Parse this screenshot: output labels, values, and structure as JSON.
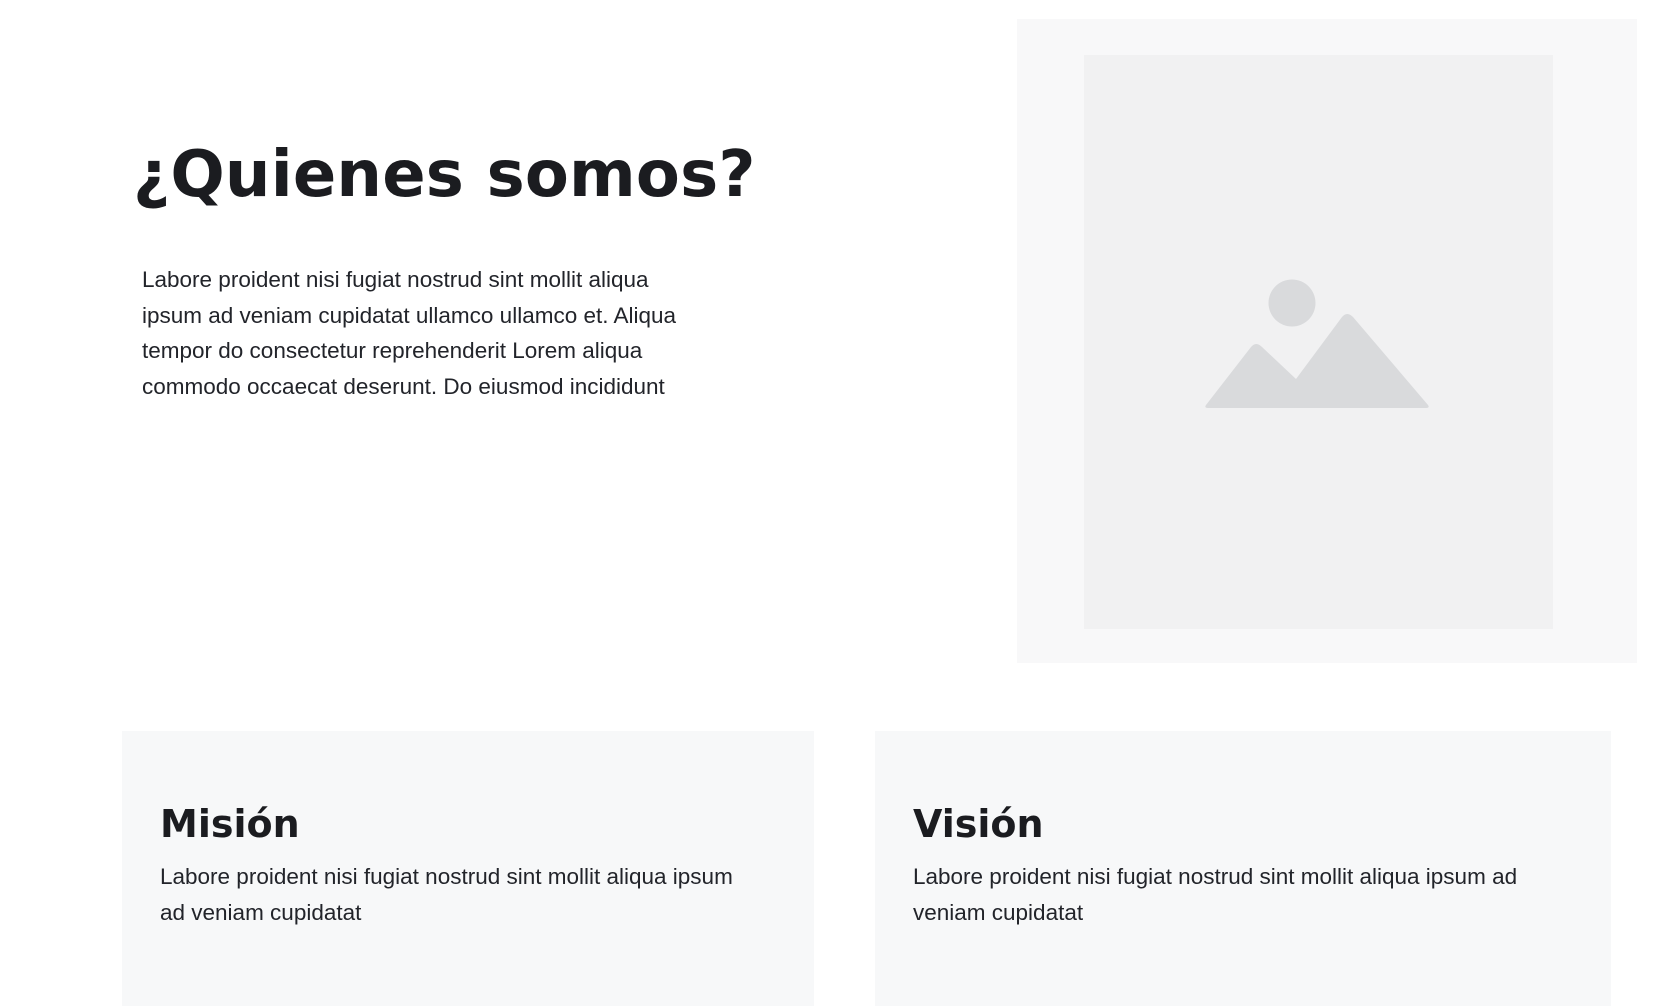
{
  "about": {
    "title": "¿Quienes somos?",
    "body": "Labore proident nisi fugiat nostrud sint mollit aliqua ipsum ad veniam cupidatat ullamco ullamco et. Aliqua tempor do consectetur reprehenderit Lorem aliqua commodo occaecat deserunt. Do eiusmod incididunt",
    "image_icon": "image-placeholder-icon"
  },
  "cards": [
    {
      "title": "Misión",
      "body": "Labore proident nisi fugiat nostrud sint mollit aliqua ipsum ad veniam cupidatat"
    },
    {
      "title": "Visión",
      "body": "Labore proident nisi fugiat nostrud sint mollit aliqua ipsum ad veniam cupidatat"
    }
  ],
  "colors": {
    "text": "#1b1c20",
    "panel_bg": "#f8f8f9",
    "image_bg": "#f1f1f2",
    "icon": "#d9dadc"
  }
}
